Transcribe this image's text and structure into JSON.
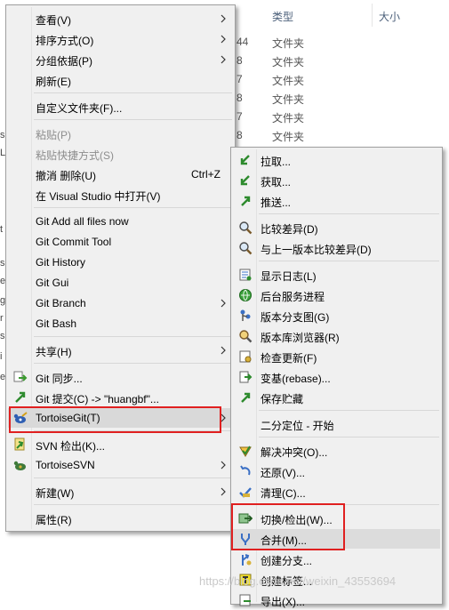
{
  "background": {
    "columns": {
      "type": "类型",
      "size": "大小"
    },
    "rows": [
      {
        "num": "44",
        "type": "文件夹"
      },
      {
        "num": "8",
        "type": "文件夹"
      },
      {
        "num": "7",
        "type": "文件夹"
      },
      {
        "num": "8",
        "type": "文件夹"
      },
      {
        "num": "7",
        "type": "文件夹"
      },
      {
        "num": "8",
        "type": "文件夹"
      }
    ],
    "left_fragments": [
      "s",
      "LL",
      "t",
      "s",
      "e",
      "g",
      "r",
      "s",
      "i",
      "e"
    ]
  },
  "context_menu": {
    "view": "查看(V)",
    "sort_by": "排序方式(O)",
    "group_by": "分组依据(P)",
    "refresh": "刷新(E)",
    "customize_folder": "自定义文件夹(F)...",
    "paste": "粘贴(P)",
    "paste_shortcut": "粘贴快捷方式(S)",
    "undo_delete": "撤消 删除(U)",
    "undo_shortcut": "Ctrl+Z",
    "open_in_vs": "在 Visual Studio 中打开(V)",
    "git_add_all": "Git Add all files now",
    "git_commit_tool": "Git Commit Tool",
    "git_history": "Git History",
    "git_gui": "Git Gui",
    "git_branch": "Git Branch",
    "git_bash": "Git Bash",
    "share": "共享(H)",
    "git_sync": "Git 同步...",
    "git_commit": "Git 提交(C) -> \"huangbf\"...",
    "tortoise_git": "TortoiseGit(T)",
    "svn_checkout": "SVN 检出(K)...",
    "tortoise_svn": "TortoiseSVN",
    "new": "新建(W)",
    "properties": "属性(R)"
  },
  "tortoise_submenu": {
    "pull": "拉取...",
    "fetch": "获取...",
    "push": "推送...",
    "diff": "比较差异(D)",
    "diff_prev": "与上一版本比较差异(D)",
    "show_log": "显示日志(L)",
    "daemon": "后台服务进程",
    "revision_graph": "版本分支图(G)",
    "repo_browser": "版本库浏览器(R)",
    "check_updates": "检查更新(F)",
    "rebase": "变基(rebase)...",
    "stash_save": "保存贮藏",
    "bisect_start": "二分定位 - 开始",
    "resolve": "解决冲突(O)...",
    "revert": "还原(V)...",
    "clean": "清理(C)...",
    "switch_checkout": "切换/检出(W)...",
    "merge": "合并(M)...",
    "create_branch": "创建分支...",
    "create_tag": "创建标签...",
    "export": "导出(X)..."
  },
  "watermark": "https://blog.csdn.net/weixin_43553694",
  "colors": {
    "menu_bg": "#f0f0f0",
    "highlight": "#d9d9d9",
    "annotation_red": "#e02020",
    "disabled_text": "#8d8d8d"
  }
}
